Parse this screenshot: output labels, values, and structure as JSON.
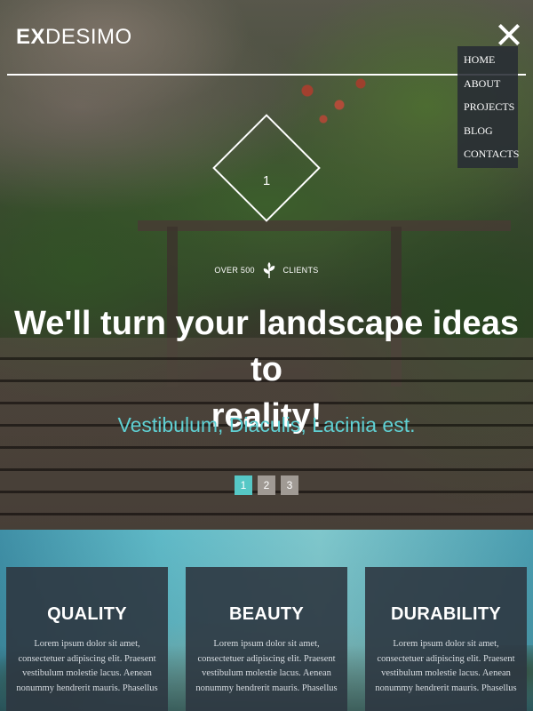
{
  "brand": {
    "bold": "EX",
    "rest": "DESIMO"
  },
  "menu": {
    "items": [
      "HOME",
      "ABOUT",
      "PROJECTS",
      "BLOG",
      "CONTACTS"
    ]
  },
  "hero": {
    "slide_number": "1",
    "clients_left": "OVER 500",
    "clients_right": "CLIENTS",
    "headline_line1": "We'll turn your landscape ideas to",
    "headline_line2": "reality!",
    "subline": "Vestibulum, Diaculis, Lacinia est.",
    "pager": [
      "1",
      "2",
      "3"
    ],
    "active_page": "1"
  },
  "features": [
    {
      "title": "QUALITY",
      "text": "Lorem ipsum dolor sit amet, consectetuer adipiscing elit. Praesent vestibulum molestie lacus. Aenean nonummy hendrerit mauris. Phasellus"
    },
    {
      "title": "BEAUTY",
      "text": "Lorem ipsum dolor sit amet, consectetuer adipiscing elit. Praesent vestibulum molestie lacus. Aenean nonummy hendrerit mauris. Phasellus"
    },
    {
      "title": "DURABILITY",
      "text": "Lorem ipsum dolor sit amet, consectetuer adipiscing elit. Praesent vestibulum molestie lacus. Aenean nonummy hendrerit mauris. Phasellus"
    }
  ],
  "colors": {
    "accent": "#56c8c6",
    "subline": "#5fd0d3",
    "menu_bg": "#282c34",
    "card_bg": "#2d3741"
  },
  "icons": {
    "close": "close-icon",
    "leaf": "leaf-icon"
  }
}
